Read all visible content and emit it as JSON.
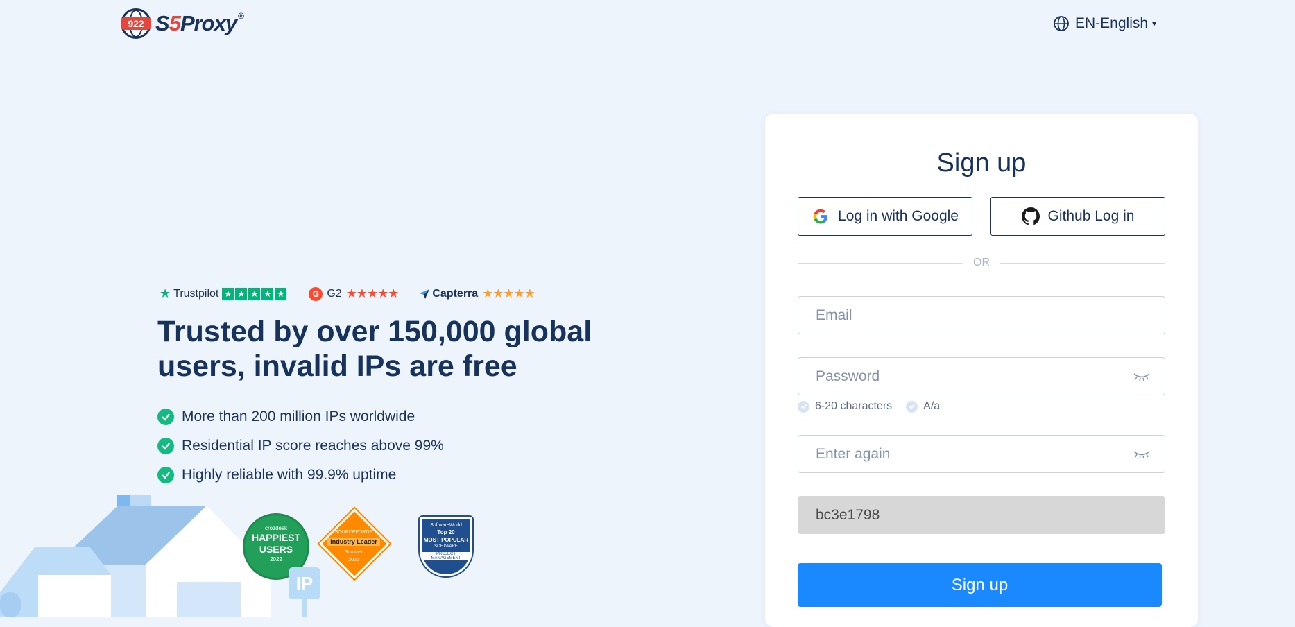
{
  "header": {
    "logo_badge": "922",
    "logo_prefix": "S",
    "logo_five": "5",
    "logo_suffix": "Proxy",
    "logo_reg": "®",
    "language": "EN-English",
    "language_caret": "▾"
  },
  "ratings": {
    "trustpilot": "Trustpilot",
    "g2": "G2",
    "g2_logo": "G",
    "capterra": "Capterra",
    "stars": "★★★★★"
  },
  "hero": {
    "headline": "Trusted by over 150,000 global users, invalid IPs are free",
    "features": [
      "More than 200 million IPs worldwide",
      "Residential IP score reaches above 99%",
      "Highly reliable with 99.9% uptime"
    ]
  },
  "badges": {
    "crozdesk": {
      "brand": "crozdesk",
      "title_line1": "HAPPIEST",
      "title_line2": "USERS",
      "year": "2022"
    },
    "sourceforge": {
      "brand": "SOURCEFORGE",
      "title": "Industry Leader",
      "season": "Summer",
      "year": "2022"
    },
    "softwareworld": {
      "brand": "SoftwareWorld",
      "top": "Top 20",
      "title": "MOST POPULAR",
      "sub": "SOFTWARE",
      "category": "PROJECT MANAGEMENT"
    },
    "ip_sign": "IP"
  },
  "signup": {
    "title": "Sign up",
    "google_label": "Log in with Google",
    "github_label": "Github Log in",
    "or_text": "OR",
    "email_placeholder": "Email",
    "password_placeholder": "Password",
    "hint_length": "6-20 characters",
    "hint_case": "A/a",
    "again_placeholder": "Enter again",
    "invite_code": "bc3e1798",
    "submit_label": "Sign up"
  },
  "colors": {
    "background": "#eef4fc",
    "primary": "#1a88ff",
    "navy": "#17335c",
    "success": "#16b981",
    "brand_red": "#e2483d"
  }
}
